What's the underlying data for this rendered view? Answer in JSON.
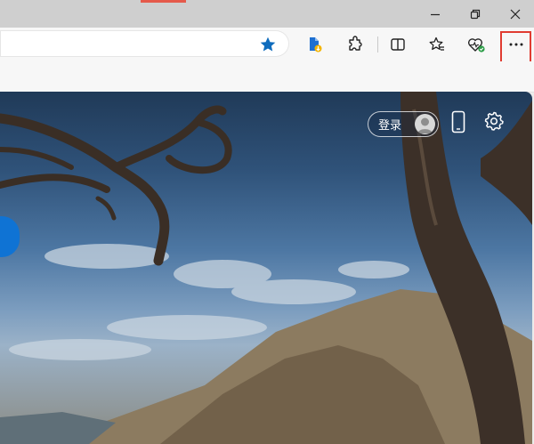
{
  "window": {
    "minimize_icon": "minimize-icon",
    "restore_icon": "restore-icon",
    "close_icon": "close-icon"
  },
  "toolbar": {
    "favorite_icon": "star-filled-icon",
    "favorite_color": "#0f6cbd",
    "icons": [
      "document-download-icon",
      "extensions-icon",
      "split-screen-icon",
      "favorites-icon",
      "browser-essentials-icon",
      "more-icon"
    ],
    "more_highlight_color": "#e03c31"
  },
  "newtab": {
    "signin_label": "登录",
    "phone_icon": "phone-icon",
    "settings_icon": "gear-icon",
    "background": "landscape-photo"
  }
}
